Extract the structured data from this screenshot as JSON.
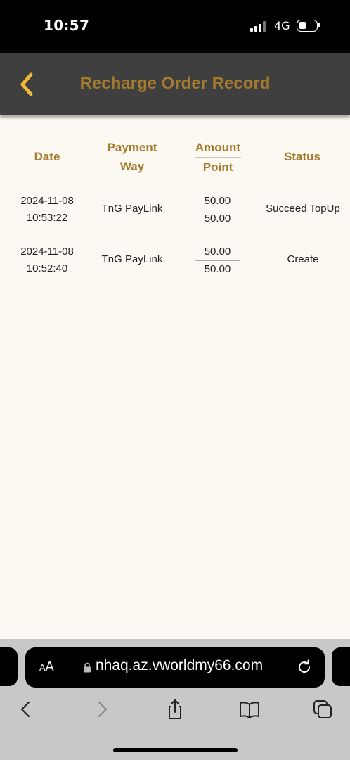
{
  "status_bar": {
    "time": "10:57",
    "network": "4G",
    "icons": [
      "signal-icon",
      "battery-icon"
    ]
  },
  "header": {
    "title": "Recharge Order Record",
    "back_icon": "chevron-left-icon",
    "accent_color": "#a47a2c",
    "back_color": "#f0b93a",
    "background": "#3f3f3f"
  },
  "table": {
    "columns": {
      "date": "Date",
      "payment_line1": "Payment",
      "payment_line2": "Way",
      "amount": "Amount",
      "point": "Point",
      "status": "Status"
    },
    "rows": [
      {
        "date": "2024-11-08",
        "time": "10:53:22",
        "payment": "TnG PayLink",
        "amount": "50.00",
        "point": "50.00",
        "status": "Succeed TopUp"
      },
      {
        "date": "2024-11-08",
        "time": "10:52:40",
        "payment": "TnG PayLink",
        "amount": "50.00",
        "point": "50.00",
        "status": "Create"
      }
    ]
  },
  "browser": {
    "aa_label_small": "A",
    "aa_label_large": "A",
    "url": "nhaq.az.vworldmy66.com",
    "icons": [
      "lock-icon",
      "reload-icon",
      "back-icon",
      "forward-icon",
      "share-icon",
      "bookmarks-icon",
      "tabs-icon"
    ]
  }
}
